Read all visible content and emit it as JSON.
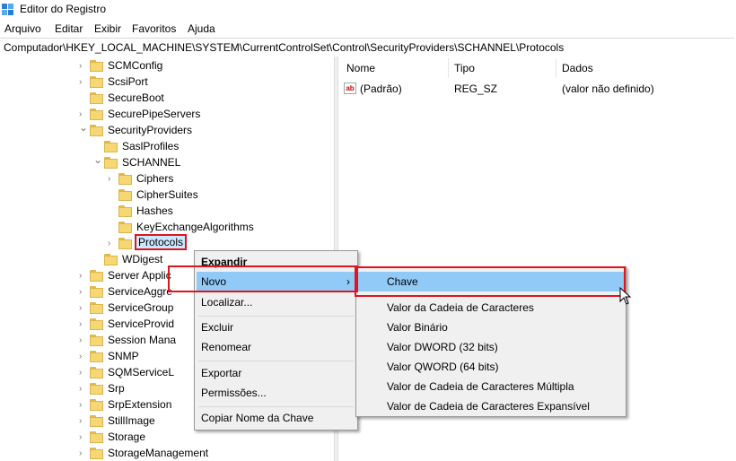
{
  "window": {
    "title": "Editor do Registro",
    "icon": "registry-editor-icon"
  },
  "menubar": [
    "Arquivo",
    "Editar",
    "Exibir",
    "Favoritos",
    "Ajuda"
  ],
  "address": "Computador\\HKEY_LOCAL_MACHINE\\SYSTEM\\CurrentControlSet\\Control\\SecurityProviders\\SCHANNEL\\Protocols",
  "tree": [
    "SCMConfig",
    "ScsiPort",
    "SecureBoot",
    "SecurePipeServers",
    "SecurityProviders",
    "SaslProfiles",
    "SCHANNEL",
    "Ciphers",
    "CipherSuites",
    "Hashes",
    "KeyExchangeAlgorithms",
    "Protocols",
    "WDigest",
    "Server Applic",
    "ServiceAggre",
    "ServiceGroup",
    "ServiceProvid",
    "Session Mana",
    "SNMP",
    "SQMServiceL",
    "Srp",
    "SrpExtension",
    "StillImage",
    "Storage",
    "StorageManagement"
  ],
  "columns": {
    "name": "Nome",
    "type": "Tipo",
    "data": "Dados"
  },
  "values": [
    {
      "name": "(Padrão)",
      "type": "REG_SZ",
      "data": "(valor não definido)",
      "icon": "string-value-icon"
    }
  ],
  "context_menu": {
    "expand": "Expandir",
    "new": "Novo",
    "find": "Localizar...",
    "delete": "Excluir",
    "rename": "Renomear",
    "export": "Exportar",
    "permissions": "Permissões...",
    "copy_key_name": "Copiar Nome da Chave"
  },
  "submenu": {
    "key": "Chave",
    "string_value": "Valor da Cadeia de Caracteres",
    "binary_value": "Valor Binário",
    "dword_value": "Valor DWORD (32 bits)",
    "qword_value": "Valor QWORD (64 bits)",
    "multi_string_value": "Valor de Cadeia de Caracteres Múltipla",
    "expandable_string_value": "Valor de Cadeia de Caracteres Expansível"
  },
  "colors": {
    "highlight": "#91c9f7",
    "annotation": "#e0141e",
    "folder": "#f5d774"
  }
}
